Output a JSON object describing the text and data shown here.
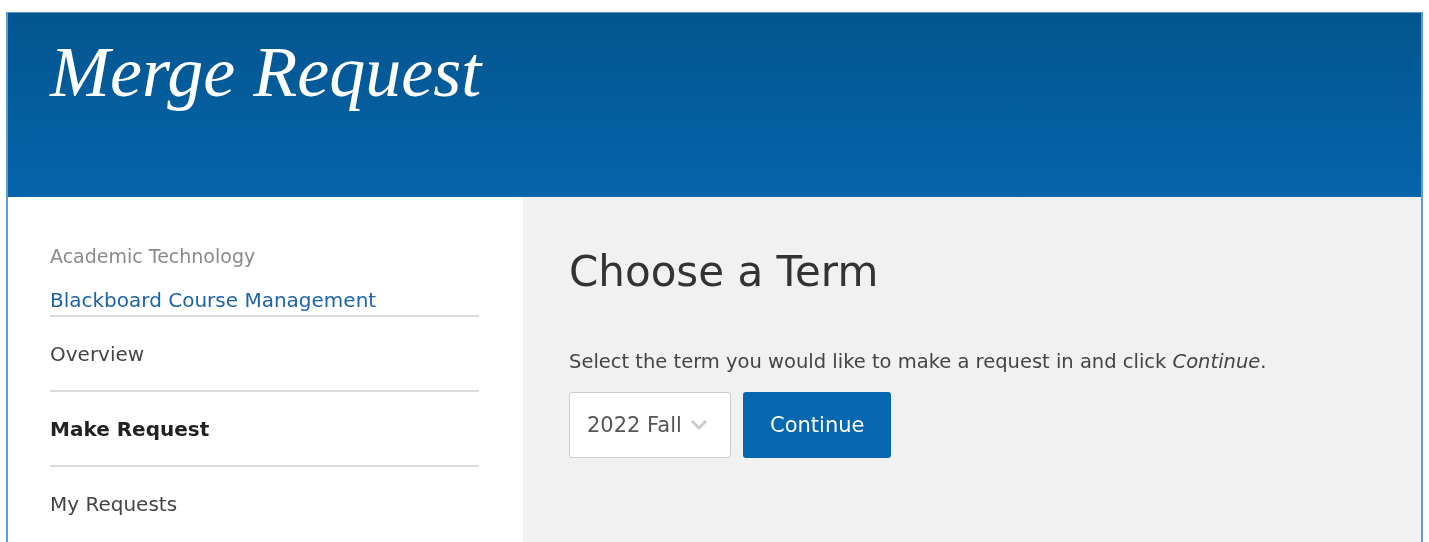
{
  "header": {
    "title": "Merge Request"
  },
  "sidebar": {
    "section_label": "Academic Technology",
    "title_link": "Blackboard Course Management",
    "items": [
      {
        "label": "Overview",
        "selected": false
      },
      {
        "label": "Make Request",
        "selected": true
      },
      {
        "label": "My Requests",
        "selected": false
      }
    ]
  },
  "main": {
    "heading": "Choose a Term",
    "instruction": "Select the term you would like to make a request in and click *Continue*.",
    "term_select": {
      "value": "2022 Fall"
    },
    "button": "Continue"
  }
}
